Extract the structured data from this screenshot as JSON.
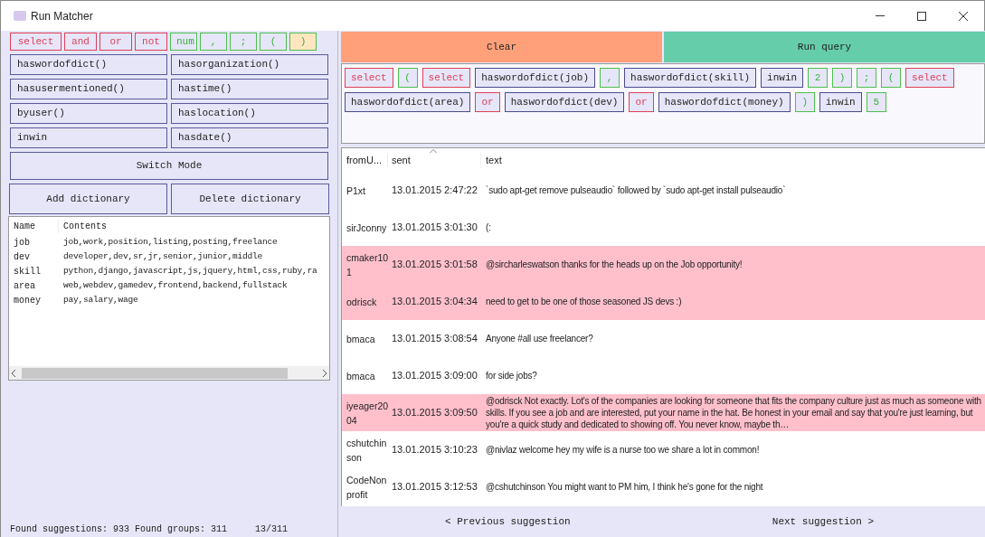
{
  "window": {
    "title": "Run Matcher"
  },
  "palette": [
    {
      "label": "select",
      "kind": "keyword",
      "selected": false
    },
    {
      "label": "and",
      "kind": "keyword",
      "selected": false
    },
    {
      "label": "or",
      "kind": "keyword",
      "selected": false
    },
    {
      "label": "not",
      "kind": "keyword",
      "selected": false
    },
    {
      "label": "num",
      "kind": "literal",
      "selected": false
    },
    {
      "label": ",",
      "kind": "literal",
      "selected": false
    },
    {
      "label": ";",
      "kind": "literal",
      "selected": false
    },
    {
      "label": "(",
      "kind": "literal",
      "selected": false
    },
    {
      "label": ")",
      "kind": "literal",
      "selected": true
    }
  ],
  "functions": [
    "haswordofdict()",
    "hasorganization()",
    "hasusermentioned()",
    "hastime()",
    "byuser()",
    "haslocation()",
    "inwin",
    "hasdate()"
  ],
  "switch_mode": "Switch Mode",
  "dict_buttons": [
    "Add dictionary",
    "Delete dictionary"
  ],
  "dictionary": {
    "columns": [
      "Name",
      "Contents"
    ],
    "rows": [
      {
        "name": "job",
        "contents": "job,work,position,listing,posting,freelance"
      },
      {
        "name": "dev",
        "contents": "developer,dev,sr,jr,senior,junior,middle"
      },
      {
        "name": "skill",
        "contents": "python,django,javascript,js,jquery,html,css,ruby,ra"
      },
      {
        "name": "area",
        "contents": "web,webdev,gamedev,frontend,backend,fullstack"
      },
      {
        "name": "money",
        "contents": "pay,salary,wage"
      }
    ]
  },
  "status": {
    "summary": "Found suggestions: 933 Found groups: 311",
    "position": "13/311"
  },
  "actions": [
    "Clear",
    "Run query"
  ],
  "query": [
    {
      "label": "select",
      "kind": "keyword"
    },
    {
      "label": "(",
      "kind": "literal"
    },
    {
      "label": "select",
      "kind": "keyword"
    },
    {
      "label": "haswordofdict(job)",
      "kind": "func"
    },
    {
      "label": ",",
      "kind": "literal"
    },
    {
      "label": "haswordofdict(skill)",
      "kind": "func"
    },
    {
      "label": "inwin",
      "kind": "func"
    },
    {
      "label": "2",
      "kind": "literal"
    },
    {
      "label": ")",
      "kind": "literal"
    },
    {
      "label": ";",
      "kind": "literal"
    },
    {
      "label": "(",
      "kind": "literal"
    },
    {
      "label": "select",
      "kind": "keyword"
    },
    {
      "label": "haswordofdict(area)",
      "kind": "func"
    },
    {
      "label": "or",
      "kind": "keyword"
    },
    {
      "label": "haswordofdict(dev)",
      "kind": "func"
    },
    {
      "label": "or",
      "kind": "keyword"
    },
    {
      "label": "haswordofdict(money)",
      "kind": "func"
    },
    {
      "label": ")",
      "kind": "literal"
    },
    {
      "label": "inwin",
      "kind": "func"
    },
    {
      "label": "5",
      "kind": "literal"
    }
  ],
  "messages": {
    "columns": [
      "fromU...",
      "sent",
      "text"
    ],
    "rows": [
      {
        "user": "P1xt",
        "sent": "13.01.2015 2:47:22",
        "text": "`sudo apt-get remove pulseaudio` followed by `sudo apt-get install pulseaudio`",
        "highlighted": false
      },
      {
        "user": "sirJconny",
        "sent": "13.01.2015 3:01:30",
        "text": "(:",
        "highlighted": false
      },
      {
        "user": "cmaker101",
        "sent": "13.01.2015 3:01:58",
        "text": "@sircharleswatson thanks for the heads up on the Job opportunity!",
        "highlighted": true
      },
      {
        "user": "odrisck",
        "sent": "13.01.2015 3:04:34",
        "text": "need to get to be one of those seasoned JS devs :)",
        "highlighted": true
      },
      {
        "user": "bmaca",
        "sent": "13.01.2015 3:08:54",
        "text": "Anyone #all use freelancer?",
        "highlighted": false
      },
      {
        "user": "bmaca",
        "sent": "13.01.2015 3:09:00",
        "text": "for side jobs?",
        "highlighted": false
      },
      {
        "user": "iyeager2004",
        "sent": "13.01.2015 3:09:50",
        "text": "@odrisck Not exactly. Lot's of the companies are looking for someone that fits the company culture just as much as someone with skills. If you see a job and are interested, put your name in the hat. Be honest in your email and say that you're just learning, but you're a quick study and dedicated to showing off. You never know, maybe th…",
        "highlighted": true
      },
      {
        "user": "cshutchinson",
        "sent": "13.01.2015 3:10:23",
        "text": "@nivlaz welcome hey my wife is a nurse too we share a lot in common!",
        "highlighted": false
      },
      {
        "user": "CodeNonprofit",
        "sent": "13.01.2015 3:12:53",
        "text": "@cshutchinson You might want to PM him, I think he's gone for the night",
        "highlighted": false
      }
    ]
  },
  "navigation": [
    "< Previous suggestion",
    "Next suggestion >"
  ]
}
